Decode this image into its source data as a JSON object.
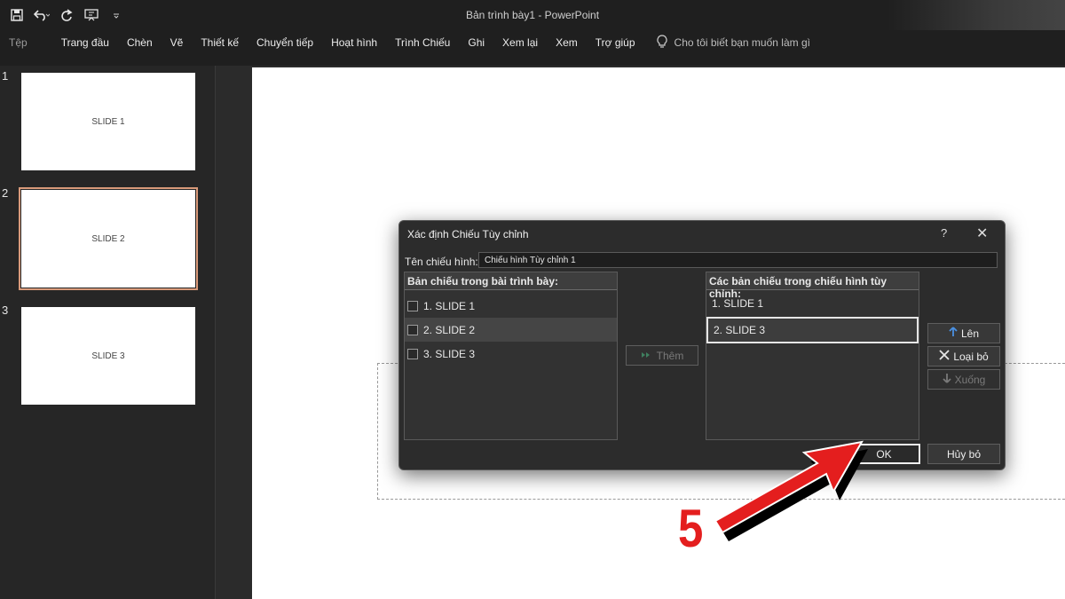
{
  "window": {
    "title": "Bản trình bày1  -  PowerPoint"
  },
  "qat": {
    "icons": [
      "save-icon",
      "undo-icon",
      "redo-icon",
      "present-icon",
      "customize-icon"
    ]
  },
  "ribbon": {
    "tabs": [
      "Tệp",
      "Trang đầu",
      "Chèn",
      "Vẽ",
      "Thiết kế",
      "Chuyển tiếp",
      "Hoạt hình",
      "Trình Chiếu",
      "Ghi",
      "Xem lại",
      "Xem",
      "Trợ giúp"
    ],
    "tell_me": "Cho tôi biết bạn muốn làm gì"
  },
  "slides": [
    {
      "num": "1",
      "text": "SLIDE 1"
    },
    {
      "num": "2",
      "text": "SLIDE 2"
    },
    {
      "num": "3",
      "text": "SLIDE 3"
    }
  ],
  "dialog": {
    "title": "Xác định Chiếu Tùy chỉnh",
    "help": "?",
    "close": "✕",
    "name_label": "Tên chiếu hình:",
    "name_value": "Chiếu hình Tùy chỉnh 1",
    "left_header": "Bản chiếu trong bài trình bày:",
    "left_items": [
      "1. SLIDE 1",
      "2. SLIDE 2",
      "3. SLIDE 3"
    ],
    "right_header": "Các bản chiếu trong chiếu hình tùy chỉnh:",
    "right_items": [
      "1. SLIDE 1",
      "2. SLIDE 3"
    ],
    "add_button": "Thêm",
    "up_button": "Lên",
    "remove_button": "Loại bỏ",
    "down_button": "Xuống",
    "ok_button": "OK",
    "cancel_button": "Hủy bỏ"
  },
  "annotation": {
    "step": "5",
    "color": "#e41e1e"
  }
}
